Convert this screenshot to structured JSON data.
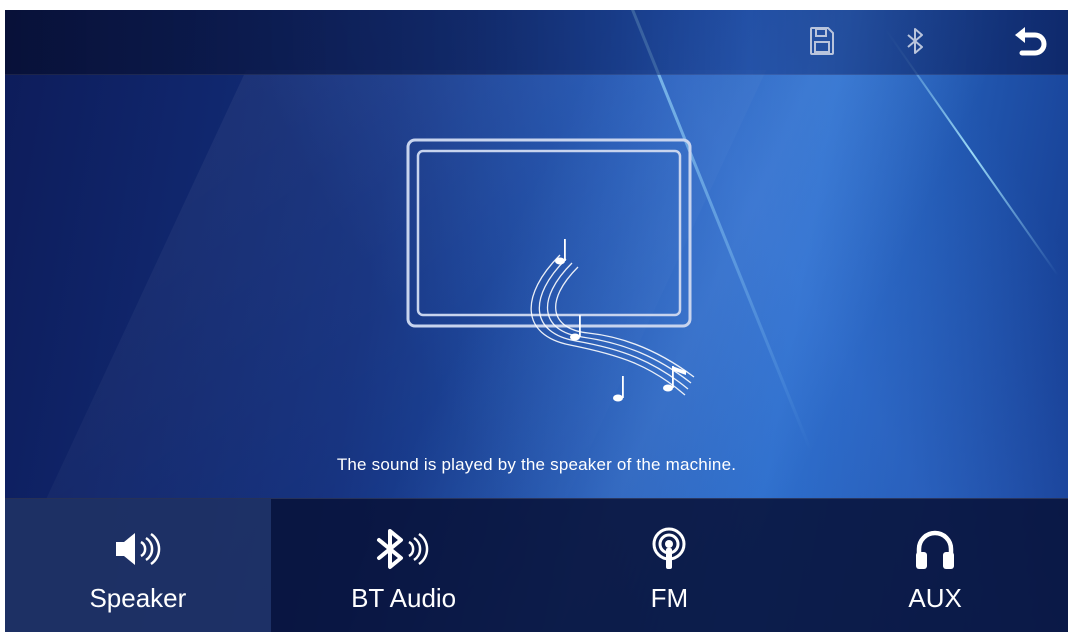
{
  "topbar": {
    "icons": [
      "save-icon",
      "bluetooth-icon",
      "back-icon"
    ]
  },
  "message": "The sound is played by the speaker of the machine.",
  "tabs": [
    {
      "label": "Speaker",
      "icon": "speaker-icon",
      "active": true
    },
    {
      "label": "BT Audio",
      "icon": "bluetooth-audio-icon",
      "active": false
    },
    {
      "label": "FM",
      "icon": "radio-broadcast-icon",
      "active": false
    },
    {
      "label": "AUX",
      "icon": "headphones-icon",
      "active": false
    }
  ],
  "colors": {
    "background_dark": "#0d1c5a",
    "background_light": "#2a6cc8",
    "tabbar": "#08123a",
    "text": "#ffffff"
  }
}
